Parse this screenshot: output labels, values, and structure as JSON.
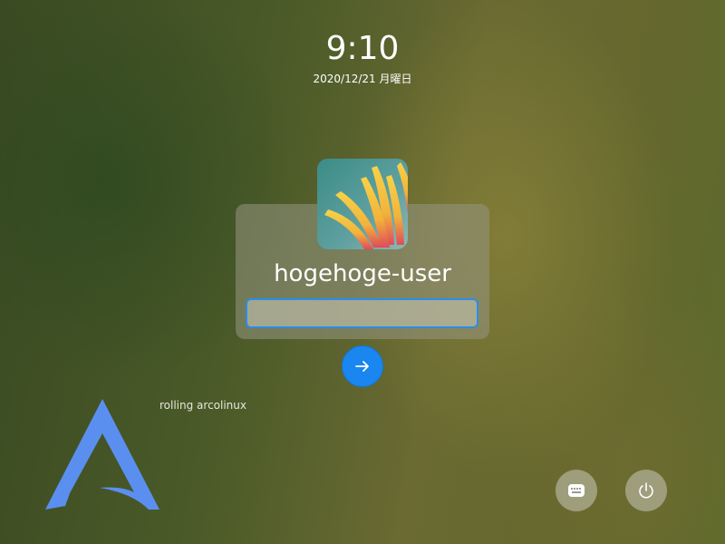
{
  "lock_screen": {
    "time": "9:10",
    "date": "2020/12/21 月曜日"
  },
  "user": {
    "username": "hogehoge-user",
    "avatar_icon": "flower-avatar"
  },
  "password": {
    "value": "",
    "placeholder": ""
  },
  "buttons": {
    "submit_icon": "arrow-right-icon",
    "keyboard_icon": "keyboard-icon",
    "power_icon": "power-icon"
  },
  "system": {
    "distro_label": "rolling arcolinux",
    "logo_icon": "arcolinux-logo"
  },
  "colors": {
    "accent": "#1a86ef",
    "logo": "#5b8fef"
  }
}
